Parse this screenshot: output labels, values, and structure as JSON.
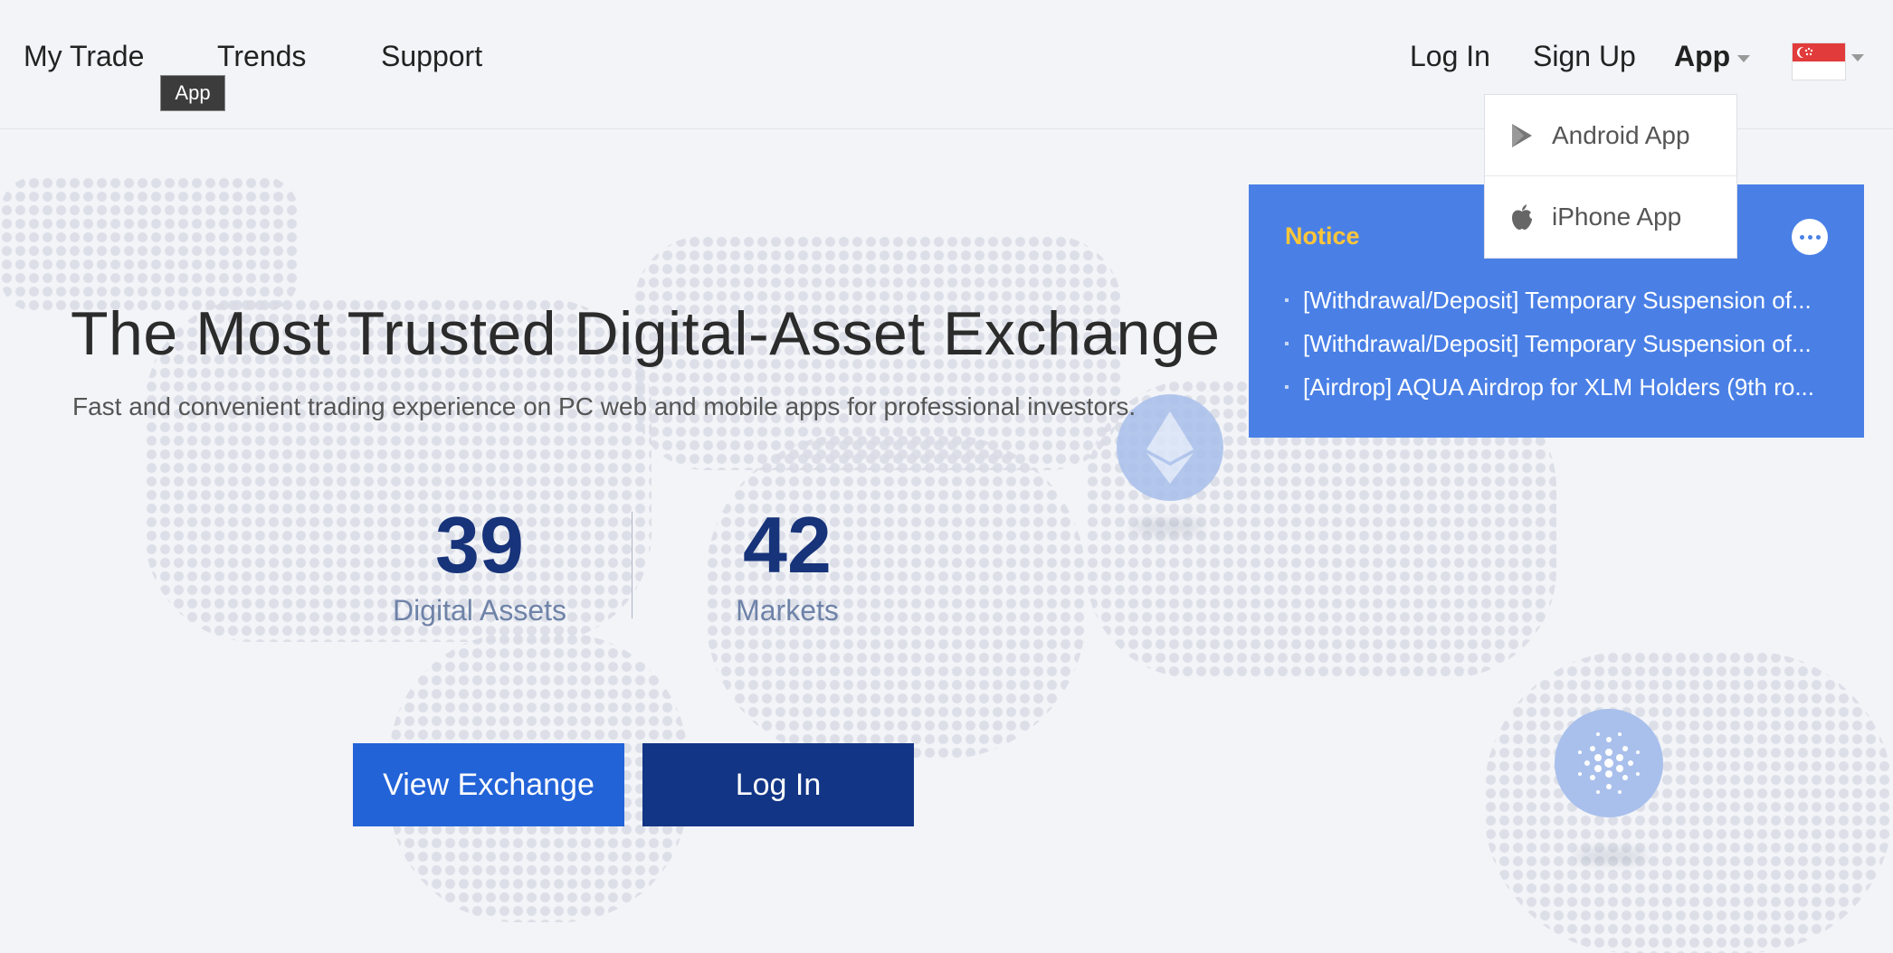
{
  "nav": {
    "left_links": [
      "My Trade",
      "Trends",
      "Support"
    ],
    "tooltip": "App",
    "login": "Log In",
    "signup": "Sign Up",
    "app": "App",
    "flag": "singapore-flag-icon"
  },
  "app_dropdown": {
    "items": [
      {
        "label": "Android App",
        "icon": "google-play-icon"
      },
      {
        "label": "iPhone App",
        "icon": "apple-icon"
      }
    ]
  },
  "notice": {
    "title": "Notice",
    "items": [
      "[Withdrawal/Deposit] Temporary Suspension of...",
      "[Withdrawal/Deposit] Temporary Suspension of...",
      "[Airdrop] AQUA Airdrop for XLM Holders (9th ro..."
    ]
  },
  "hero": {
    "title": "The Most Trusted Digital-Asset Exchange",
    "subtitle": "Fast and convenient trading experience on PC web and mobile apps for professional investors."
  },
  "stats": [
    {
      "value": "39",
      "label": "Digital Assets"
    },
    {
      "value": "42",
      "label": "Markets"
    }
  ],
  "buttons": {
    "view_exchange": "View Exchange",
    "login": "Log In"
  },
  "colors": {
    "primary": "#2263d8",
    "dark": "#123585",
    "notice_bg": "#4a80e6",
    "notice_title": "#ffc63a"
  }
}
